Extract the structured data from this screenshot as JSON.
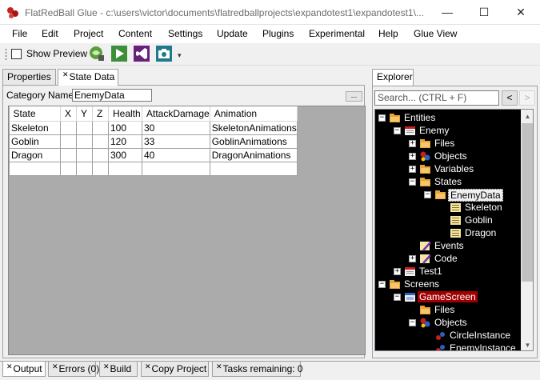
{
  "window": {
    "title": "FlatRedBall Glue - c:\\users\\victor\\documents\\flatredballprojects\\expandotest1\\expandotest1\\...",
    "min_glyph": "—",
    "max_glyph": "☐",
    "close_glyph": "✕"
  },
  "menu": [
    "File",
    "Edit",
    "Project",
    "Content",
    "Settings",
    "Update",
    "Plugins",
    "Experimental",
    "Help",
    "Glue View"
  ],
  "toolbar": {
    "show_preview_label": "Show Preview",
    "show_preview_checked": false,
    "overflow_glyph": "▾"
  },
  "left_tabs": [
    {
      "label": "Properties",
      "closable": false,
      "active": false
    },
    {
      "label": "State Data",
      "closable": true,
      "active": true
    }
  ],
  "state_data": {
    "category_label": "Category Name",
    "category_value": "EnemyData",
    "ellipsis": "...",
    "columns": [
      "State",
      "X",
      "Y",
      "Z",
      "Health",
      "AttackDamage",
      "Animation"
    ],
    "rows": [
      [
        "Skeleton",
        "",
        "",
        "",
        "100",
        "30",
        "SkeletonAnimations"
      ],
      [
        "Goblin",
        "",
        "",
        "",
        "120",
        "33",
        "GoblinAnimations"
      ],
      [
        "Dragon",
        "",
        "",
        "",
        "300",
        "40",
        "DragonAnimations"
      ]
    ]
  },
  "explorer": {
    "tab_label": "Explorer",
    "search_placeholder": "Search... (CTRL + F)",
    "back": "<",
    "forward": ">",
    "scroll_up": "▲",
    "scroll_down": "▼",
    "tree": [
      {
        "label": "Entities",
        "depth": 0,
        "expander": "−",
        "icon": "entities-folder-icon"
      },
      {
        "label": "Enemy",
        "depth": 1,
        "expander": "−",
        "icon": "entity-icon"
      },
      {
        "label": "Files",
        "depth": 2,
        "expander": "+",
        "icon": "files-folder-icon"
      },
      {
        "label": "Objects",
        "depth": 2,
        "expander": "+",
        "icon": "objects-icon"
      },
      {
        "label": "Variables",
        "depth": 2,
        "expander": "+",
        "icon": "variables-folder-icon"
      },
      {
        "label": "States",
        "depth": 2,
        "expander": "−",
        "icon": "states-folder-icon"
      },
      {
        "label": "EnemyData",
        "depth": 3,
        "expander": "−",
        "icon": "state-category-folder-icon",
        "selected": "light"
      },
      {
        "label": "Skeleton",
        "depth": 4,
        "expander": "",
        "icon": "state-icon"
      },
      {
        "label": "Goblin",
        "depth": 4,
        "expander": "",
        "icon": "state-icon"
      },
      {
        "label": "Dragon",
        "depth": 4,
        "expander": "",
        "icon": "state-icon"
      },
      {
        "label": "Events",
        "depth": 2,
        "expander": "",
        "icon": "events-icon"
      },
      {
        "label": "Code",
        "depth": 2,
        "expander": "+",
        "icon": "code-icon"
      },
      {
        "label": "Test1",
        "depth": 1,
        "expander": "+",
        "icon": "entity-icon"
      },
      {
        "label": "Screens",
        "depth": 0,
        "expander": "−",
        "icon": "screens-folder-icon"
      },
      {
        "label": "GameScreen",
        "depth": 1,
        "expander": "−",
        "icon": "screen-icon",
        "selected": "red"
      },
      {
        "label": "Files",
        "depth": 2,
        "expander": "",
        "icon": "files-folder-icon"
      },
      {
        "label": "Objects",
        "depth": 2,
        "expander": "−",
        "icon": "objects-icon"
      },
      {
        "label": "CircleInstance",
        "depth": 3,
        "expander": "",
        "icon": "object-instance-icon"
      },
      {
        "label": "EnemyInstance",
        "depth": 3,
        "expander": "",
        "icon": "object-instance-icon"
      }
    ]
  },
  "bottom_tabs": [
    {
      "label": "Output",
      "active": true
    },
    {
      "label": "Errors (0)",
      "active": false
    },
    {
      "label": "Build",
      "active": false
    },
    {
      "label": "Copy Project",
      "active": false
    },
    {
      "label": "Tasks remaining: 0",
      "active": false
    }
  ],
  "colors": {
    "tree_background": "#000000",
    "selection_red": "#a00000",
    "folder_orange": "#e8a33a",
    "entity_red": "#c81e1e"
  }
}
